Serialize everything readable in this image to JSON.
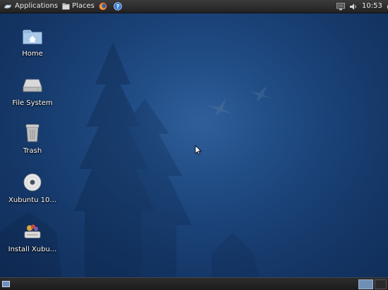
{
  "top_panel": {
    "applications_label": "Applications",
    "places_label": "Places",
    "clock": "10:53"
  },
  "desktop": {
    "icons": [
      {
        "label": "Home",
        "icon": "home-folder-icon"
      },
      {
        "label": "File System",
        "icon": "drive-icon"
      },
      {
        "label": "Trash",
        "icon": "trash-icon"
      },
      {
        "label": "Xubuntu 10...",
        "icon": "cd-disc-icon"
      },
      {
        "label": "Install Xubu...",
        "icon": "installer-icon"
      }
    ]
  },
  "colors": {
    "wallpaper_center": "#2f5f9a",
    "wallpaper_edge": "#0f2b55",
    "panel": "#2a2a2a",
    "panel_text": "#e8e8e8"
  }
}
